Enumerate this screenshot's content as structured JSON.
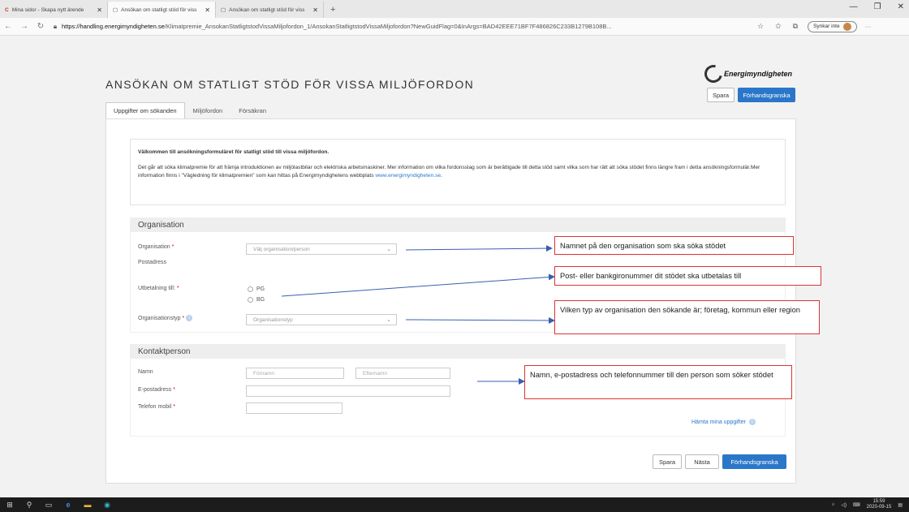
{
  "browser": {
    "tabs": [
      {
        "label": "Mina sidor - Skapa nytt ärende",
        "active": false,
        "icon": "energimyndigheten-logo-icon"
      },
      {
        "label": "Ansökan om statligt stöd för viss",
        "active": true,
        "icon": "page-icon"
      },
      {
        "label": "Ansökan om statligt stöd för viss",
        "active": false,
        "icon": "page-icon"
      }
    ],
    "url_host": "https://handling.energimyndigheten.se",
    "url_path": "/Klimatpremie_AnsokanStatligtstodVissaMiljofordon_1/AnsokanStatligtstodVissaMiljofordon?NewGuidFlag=0&InArgs=BAD42EEE71BF7F486826C233B1279B108B...",
    "sync_label": "Synkar inte"
  },
  "header": {
    "title": "ANSÖKAN OM STATLIGT STÖD FÖR VISSA MILJÖFORDON",
    "logo_text": "Energimyndigheten",
    "save_label": "Spara",
    "preview_label": "Förhandsgranska"
  },
  "tabs": [
    "Uppgifter om sökanden",
    "Miljöfordon",
    "Försäkran"
  ],
  "intro": {
    "welcome": "Välkommen till ansökningsformuläret för statligt stöd till vissa miljöfordon.",
    "body": "Det går att söka klimatpremie för att främja introduktionen av miljölastbilar och elektriska arbetsmaskiner. Mer information om vilka fordonsslag som är berättigade till detta stöd samt vilka som har rätt att söka stödet finns längre fram i detta ansökningsformulär.Mer information finns i \"Vägledning för klimatpremien\" som kan hittas på Energimyndighetens webbplats ",
    "link": "www.energimyndigheten.se",
    "link_suffix": "."
  },
  "organisation": {
    "heading": "Organisation",
    "org_label": "Organisation",
    "org_placeholder": "Välj organisation/person",
    "postaddress_label": "Postadress",
    "payment_label": "Utbetalning till:",
    "payment_options": [
      "PG",
      "BG"
    ],
    "orgtype_label": "Organisationstyp",
    "orgtype_placeholder": "Organisationstyp"
  },
  "contact": {
    "heading": "Kontaktperson",
    "name_label": "Namn",
    "first_placeholder": "Förnamn",
    "last_placeholder": "Efternamn",
    "email_label": "E-postadress",
    "phone_label": "Telefon mobil",
    "fetch_label": "Hämta mina uppgifter"
  },
  "footer": {
    "save_label": "Spara",
    "next_label": "Nästa",
    "preview_label": "Förhandsgranska"
  },
  "callouts": [
    "Namnet på den organisation som ska söka stödet",
    "Post- eller bankgironummer dit stödet ska utbetalas till",
    "Vilken typ av organisation den sökande är; företag, kommun eller region",
    "Namn, e-postadress och telefonnummer till den person som söker stödet"
  ],
  "taskbar": {
    "time": "15:59",
    "date": "2020-09-15"
  },
  "colors": {
    "primary": "#2a77c9",
    "required": "#d0021b",
    "callout_border": "#d33333"
  }
}
